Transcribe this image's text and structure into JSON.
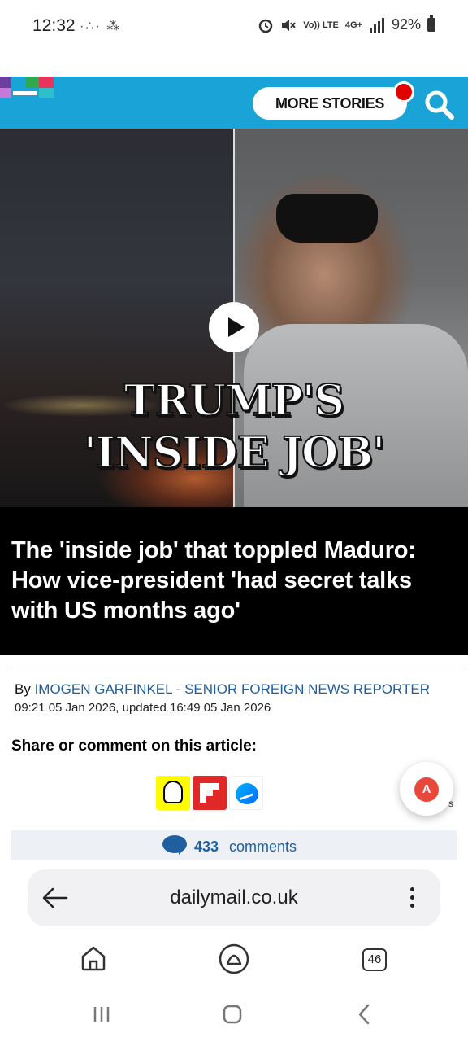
{
  "status_bar": {
    "time": "12:32",
    "left_icons": "·∴· ⁂",
    "battery": "92%",
    "network_a": "Vo)) LTE",
    "network_b": "4G+"
  },
  "header": {
    "more_stories_label": "MORE STORIES"
  },
  "hero": {
    "overlay_line_1": "TRUMP'S",
    "overlay_line_2": "'INSIDE JOB'"
  },
  "article": {
    "headline": "The 'inside job' that toppled Maduro: How vice-president 'had secret talks with US months ago'",
    "by_prefix": "By ",
    "author": "IMOGEN GARFINKEL - SENIOR FOREIGN NEWS REPORTER",
    "dateline": "09:21 05 Jan 2026, updated 16:49 05 Jan 2026",
    "share_heading": "Share or comment on this article:",
    "share_stub_letter": "s",
    "translate_glyph": "A",
    "comment_count": "433",
    "comment_label": "comments"
  },
  "browser": {
    "url": "dailymail.co.uk",
    "tab_count": "46"
  },
  "colors": {
    "brand_blue": "#1aa3d6",
    "link_blue": "#1f5fa0",
    "notification_red": "#e00000"
  },
  "icons": [
    "search-icon",
    "play-icon",
    "snapchat-icon",
    "flipboard-icon",
    "messenger-icon",
    "translate-icon",
    "comment-icon",
    "back-arrow-icon",
    "more-vert-icon",
    "home-icon",
    "assistant-icon",
    "tabs-icon",
    "recents-icon",
    "system-home-icon",
    "system-back-icon"
  ]
}
